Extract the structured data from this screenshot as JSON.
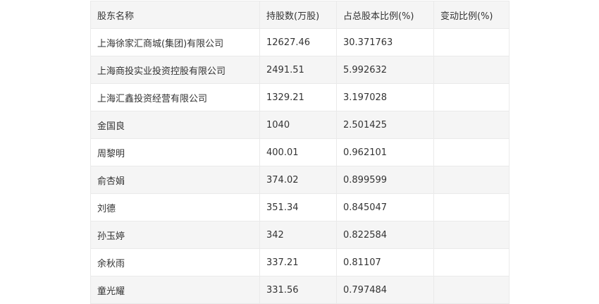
{
  "table": {
    "headers": [
      "股东名称",
      "持股数(万股)",
      "占总股本比例(%)",
      "变动比例(%)"
    ],
    "rows": [
      [
        "上海徐家汇商城(集团)有限公司",
        "12627.46",
        "30.371763",
        ""
      ],
      [
        "上海商投实业投资控股有限公司",
        "2491.51",
        "5.992632",
        ""
      ],
      [
        "上海汇鑫投资经营有限公司",
        "1329.21",
        "3.197028",
        ""
      ],
      [
        "金国良",
        "1040",
        "2.501425",
        ""
      ],
      [
        "周黎明",
        "400.01",
        "0.962101",
        ""
      ],
      [
        "俞杏娟",
        "374.02",
        "0.899599",
        ""
      ],
      [
        "刘德",
        "351.34",
        "0.845047",
        ""
      ],
      [
        "孙玉婷",
        "342",
        "0.822584",
        ""
      ],
      [
        "余秋雨",
        "337.21",
        "0.81107",
        ""
      ],
      [
        "童光耀",
        "331.56",
        "0.797484",
        ""
      ]
    ]
  }
}
